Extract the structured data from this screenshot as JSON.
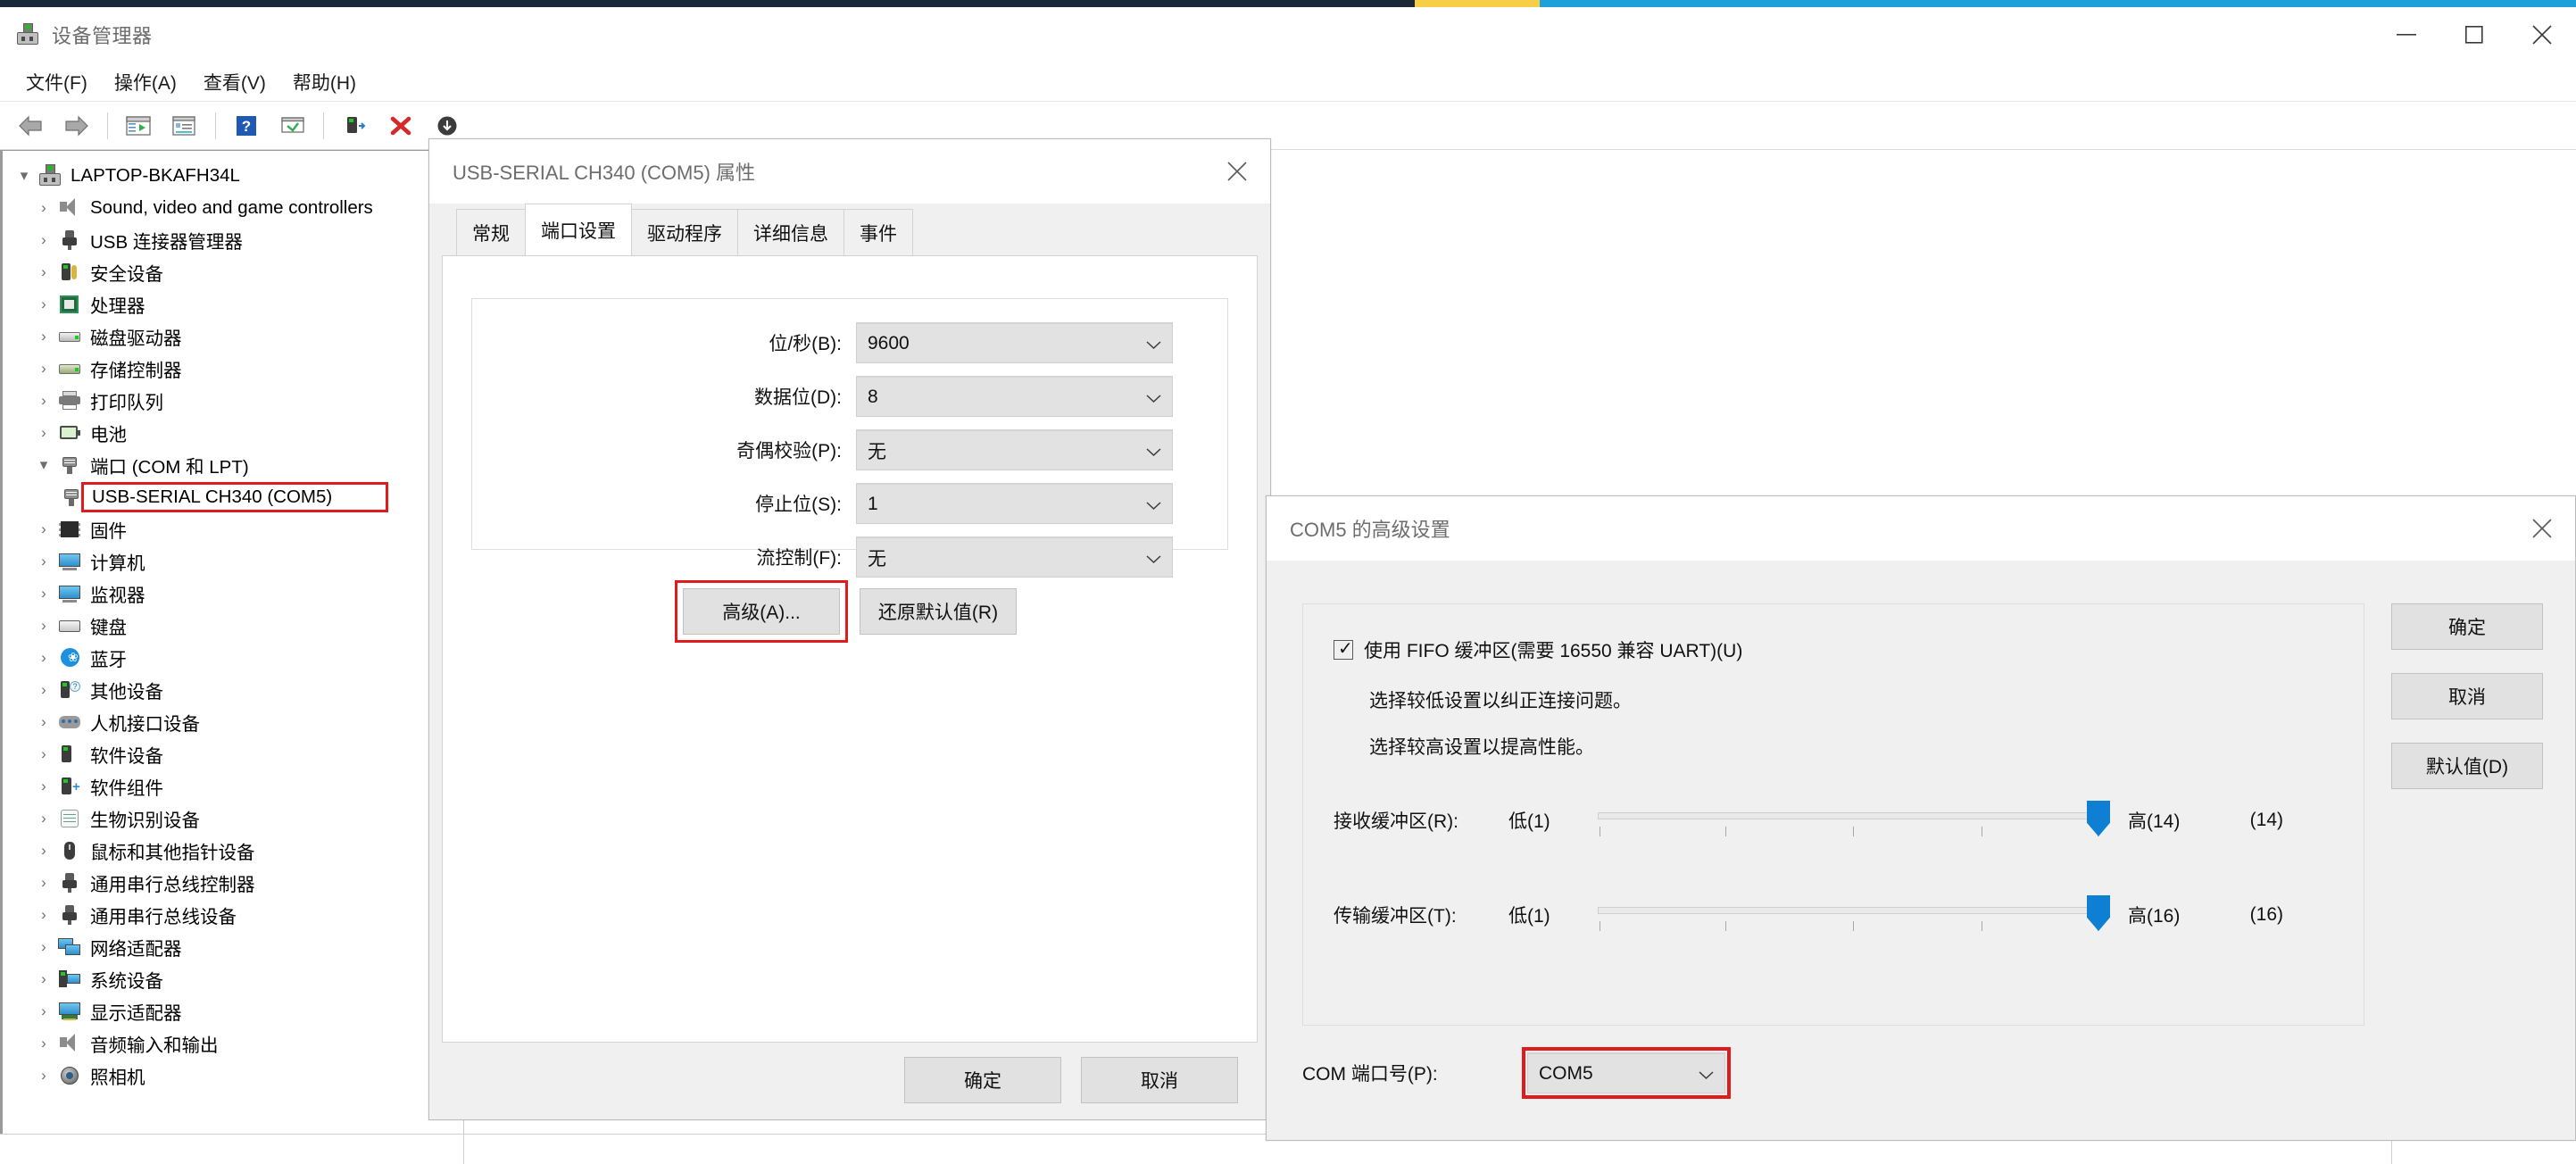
{
  "window": {
    "title": "设备管理器",
    "app_icon": "device-manager-icon",
    "minimize": "–",
    "maximize": "☐",
    "close": "✕"
  },
  "menu": {
    "items": [
      {
        "label": "文件(F)"
      },
      {
        "label": "操作(A)"
      },
      {
        "label": "查看(V)"
      },
      {
        "label": "帮助(H)"
      }
    ]
  },
  "toolbar": {
    "buttons": [
      {
        "name": "back-icon"
      },
      {
        "name": "forward-icon"
      },
      {
        "name": "show-hide-console-tree-icon"
      },
      {
        "name": "properties-icon"
      },
      {
        "name": "help-icon"
      },
      {
        "name": "scan-hardware-changes-icon"
      },
      {
        "name": "update-driver-icon"
      },
      {
        "name": "disable-device-icon"
      },
      {
        "name": "uninstall-device-icon"
      },
      {
        "name": "install-legacy-hardware-icon"
      }
    ]
  },
  "tree": {
    "root": {
      "label": "LAPTOP-BKAFH34L",
      "icon": "computer-root-icon",
      "expanded": true
    },
    "items": [
      {
        "label": "Sound, video and game controllers",
        "icon": "speaker-icon",
        "level": 1
      },
      {
        "label": "USB 连接器管理器",
        "icon": "usb-icon",
        "level": 1
      },
      {
        "label": "安全设备",
        "icon": "security-device-icon",
        "level": 1
      },
      {
        "label": "处理器",
        "icon": "processor-icon",
        "level": 1
      },
      {
        "label": "磁盘驱动器",
        "icon": "disk-drive-icon",
        "level": 1
      },
      {
        "label": "存储控制器",
        "icon": "storage-controller-icon",
        "level": 1
      },
      {
        "label": "打印队列",
        "icon": "print-queue-icon",
        "level": 1
      },
      {
        "label": "电池",
        "icon": "battery-icon",
        "level": 1
      },
      {
        "label": "端口 (COM 和 LPT)",
        "icon": "ports-icon",
        "level": 1,
        "expanded": true
      },
      {
        "label": "USB-SERIAL CH340 (COM5)",
        "icon": "port-device-icon",
        "level": 2,
        "highlighted": true
      },
      {
        "label": "固件",
        "icon": "firmware-icon",
        "level": 1
      },
      {
        "label": "计算机",
        "icon": "computer-icon",
        "level": 1
      },
      {
        "label": "监视器",
        "icon": "monitor-icon",
        "level": 1
      },
      {
        "label": "键盘",
        "icon": "keyboard-icon",
        "level": 1
      },
      {
        "label": "蓝牙",
        "icon": "bluetooth-icon",
        "level": 1
      },
      {
        "label": "其他设备",
        "icon": "other-devices-icon",
        "level": 1
      },
      {
        "label": "人机接口设备",
        "icon": "hid-icon",
        "level": 1
      },
      {
        "label": "软件设备",
        "icon": "software-device-icon",
        "level": 1
      },
      {
        "label": "软件组件",
        "icon": "software-component-icon",
        "level": 1
      },
      {
        "label": "生物识别设备",
        "icon": "biometric-icon",
        "level": 1
      },
      {
        "label": "鼠标和其他指针设备",
        "icon": "mouse-icon",
        "level": 1
      },
      {
        "label": "通用串行总线控制器",
        "icon": "usb-controller-icon",
        "level": 1
      },
      {
        "label": "通用串行总线设备",
        "icon": "usb-device-icon",
        "level": 1
      },
      {
        "label": "网络适配器",
        "icon": "network-adapter-icon",
        "level": 1
      },
      {
        "label": "系统设备",
        "icon": "system-device-icon",
        "level": 1
      },
      {
        "label": "显示适配器",
        "icon": "display-adapter-icon",
        "level": 1
      },
      {
        "label": "音频输入和输出",
        "icon": "audio-io-icon",
        "level": 1
      },
      {
        "label": "照相机",
        "icon": "camera-icon",
        "level": 1
      }
    ]
  },
  "properties_dialog": {
    "title": "USB-SERIAL CH340 (COM5) 属性",
    "close_label": "✕",
    "tabs": [
      {
        "label": "常规",
        "active": false
      },
      {
        "label": "端口设置",
        "active": true
      },
      {
        "label": "驱动程序",
        "active": false
      },
      {
        "label": "详细信息",
        "active": false
      },
      {
        "label": "事件",
        "active": false
      }
    ],
    "fields": [
      {
        "label": "位/秒(B):",
        "value": "9600"
      },
      {
        "label": "数据位(D):",
        "value": "8"
      },
      {
        "label": "奇偶校验(P):",
        "value": "无"
      },
      {
        "label": "停止位(S):",
        "value": "1"
      },
      {
        "label": "流控制(F):",
        "value": "无"
      }
    ],
    "advanced_button": "高级(A)...",
    "restore_defaults_button": "还原默认值(R)",
    "ok_button": "确定",
    "cancel_button": "取消",
    "highlight_color": "#e01b1b"
  },
  "advanced_dialog": {
    "title": "COM5 的高级设置",
    "close_label": "✕",
    "fifo_checkbox": {
      "label": "使用 FIFO 缓冲区(需要 16550 兼容 UART)(U)",
      "checked": true,
      "tick": "✓"
    },
    "hints": [
      "选择较低设置以纠正连接问题。",
      "选择较高设置以提高性能。"
    ],
    "sliders": [
      {
        "label": "接收缓冲区(R):",
        "low": "低(1)",
        "high": "高(14)",
        "value": "(14)",
        "position_pct": 96
      },
      {
        "label": "传输缓冲区(T):",
        "low": "低(1)",
        "high": "高(16)",
        "value": "(16)",
        "position_pct": 96
      }
    ],
    "com_port": {
      "label": "COM 端口号(P):",
      "value": "COM5"
    },
    "buttons": [
      {
        "label": "确定",
        "name": "ok-button"
      },
      {
        "label": "取消",
        "name": "cancel-button"
      },
      {
        "label": "默认值(D)",
        "name": "defaults-button"
      }
    ],
    "accent_color": "#0f7fd4",
    "highlight_color": "#e01b1b"
  }
}
